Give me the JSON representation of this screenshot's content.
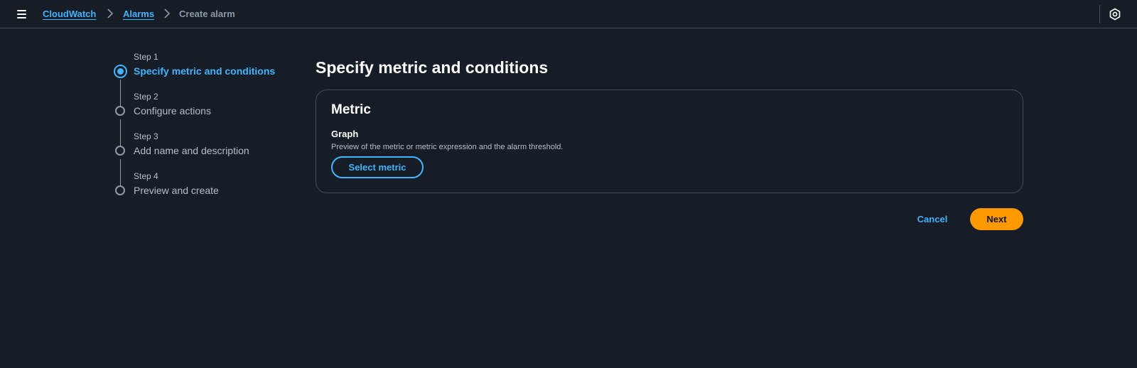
{
  "header": {
    "menu_icon": "hamburger-menu-icon",
    "breadcrumbs": [
      {
        "label": "CloudWatch",
        "link": true
      },
      {
        "label": "Alarms",
        "link": true
      },
      {
        "label": "Create alarm",
        "link": false
      }
    ],
    "separator_icon": "chevron-right-icon",
    "settings_icon": "settings-hexagon-icon"
  },
  "wizard": {
    "steps": [
      {
        "number": "Step 1",
        "title": "Specify metric and conditions",
        "state": "active"
      },
      {
        "number": "Step 2",
        "title": "Configure actions",
        "state": "pending"
      },
      {
        "number": "Step 3",
        "title": "Add name and description",
        "state": "pending"
      },
      {
        "number": "Step 4",
        "title": "Preview and create",
        "state": "pending"
      }
    ]
  },
  "main": {
    "title": "Specify metric and conditions",
    "metric_card": {
      "title": "Metric",
      "graph_label": "Graph",
      "graph_description": "Preview of the metric or metric expression and the alarm threshold.",
      "select_button": "Select metric"
    },
    "actions": {
      "cancel": "Cancel",
      "next": "Next"
    }
  },
  "colors": {
    "background": "#161d26",
    "link": "#42b4ff",
    "primary_button": "#ff9900",
    "border": "#414d5c",
    "muted_text": "#b6bec9"
  }
}
